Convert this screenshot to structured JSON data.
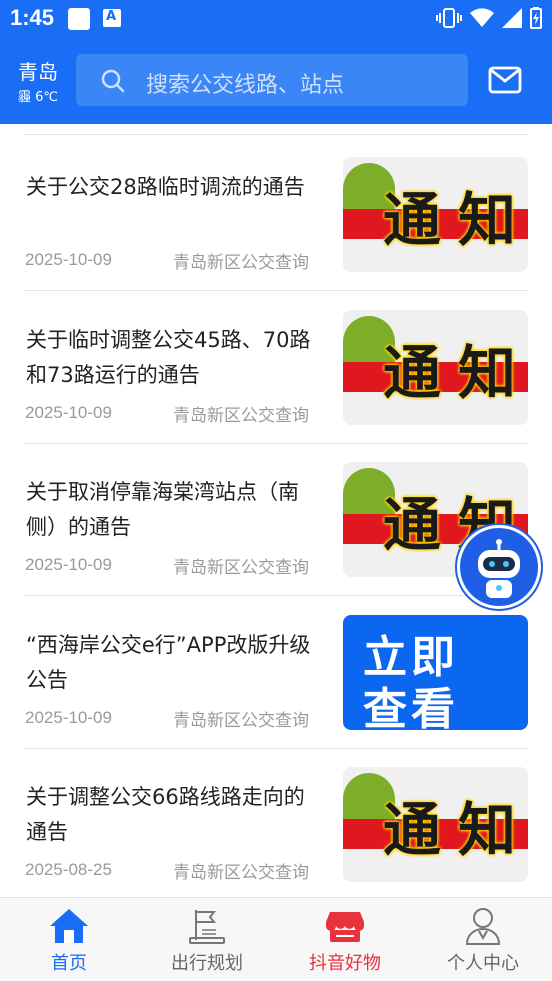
{
  "status_bar": {
    "time": "1:45"
  },
  "header": {
    "city": "青岛",
    "weather": "霾 6℃",
    "search_placeholder": "搜索公交线路、站点"
  },
  "news": [
    {
      "title": "关于公交28路临时调流的通告",
      "date": "2025-10-09",
      "source": "青岛新区公交查询",
      "thumb": "notice"
    },
    {
      "title": "关于临时调整公交45路、70路和73路运行的通告",
      "date": "2025-10-09",
      "source": "青岛新区公交查询",
      "thumb": "notice"
    },
    {
      "title": "关于取消停靠海棠湾站点（南侧）的通告",
      "date": "2025-10-09",
      "source": "青岛新区公交查询",
      "thumb": "notice"
    },
    {
      "title": "“西海岸公交e行”APP改版升级公告",
      "date": "2025-10-09",
      "source": "青岛新区公交查询",
      "thumb": "view"
    },
    {
      "title": "关于调整公交66路线路走向的通告",
      "date": "2025-08-25",
      "source": "青岛新区公交查询",
      "thumb": "notice"
    }
  ],
  "thumb_text": {
    "notice_1": "通",
    "notice_2": "知",
    "view_1": "立即",
    "view_2": "查看"
  },
  "tabs": [
    {
      "label": "首页",
      "icon": "home-icon",
      "state": "active"
    },
    {
      "label": "出行规划",
      "icon": "route-plan-icon",
      "state": "normal"
    },
    {
      "label": "抖音好物",
      "icon": "shop-icon",
      "state": "promo"
    },
    {
      "label": "个人中心",
      "icon": "user-icon",
      "state": "normal"
    }
  ],
  "colors": {
    "primary": "#1a6ef5",
    "promo": "#e8323c",
    "muted": "#9a9a9a"
  }
}
